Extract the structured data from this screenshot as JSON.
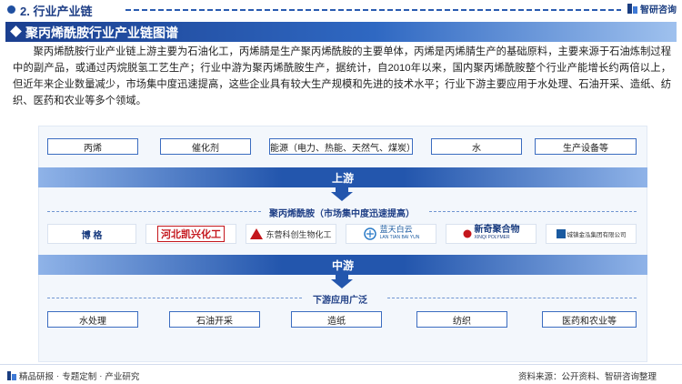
{
  "section_title": "2. 行业产业链",
  "brand": "智研咨询",
  "diagram_title": "聚丙烯酰胺行业产业链图谱",
  "intro": "聚丙烯酰胺行业产业链上游主要为石油化工，丙烯腈是生产聚丙烯酰胺的主要单体，丙烯是丙烯腈生产的基础原料，主要来源于石油炼制过程中的副产品，或通过丙烷脱氢工艺生产；行业中游为聚丙烯酰胺生产，据统计，自2010年以来，国内聚丙烯酰胺整个行业产能增长约两倍以上，但近年来企业数量减少，市场集中度迅速提高，这些企业具有较大生产规模和先进的技术水平；行业下游主要应用于水处理、石油开采、造纸、纺织、医药和农业等多个领域。",
  "upstream": {
    "items": [
      "丙烯",
      "催化剂",
      "能源（电力、热能、天然气、煤炭）",
      "水",
      "生产设备等"
    ],
    "bar_label": "上游"
  },
  "midstream": {
    "label": "聚丙烯酰胺（市场集中度迅速提高）",
    "companies": [
      "博 格",
      "河北凯兴化工",
      "东营科创生物化工",
      "蓝天白云",
      "新奇聚合物",
      "城镇金泓集团有限公司"
    ],
    "xinqi_sub": "XINQI POLYMER",
    "lantian_sub": "LAN TIAN BAI YUN",
    "bar_label": "中游"
  },
  "downstream": {
    "label": "下游应用广泛",
    "items": [
      "水处理",
      "石油开采",
      "造纸",
      "纺织",
      "医药和农业等"
    ]
  },
  "footer": {
    "left": [
      "精品研报",
      "·",
      "专题定制",
      "·",
      "产业研究"
    ],
    "source": "资料来源：公开资料、智研咨询整理"
  },
  "colors": {
    "primary": "#2356ad",
    "dark": "#1f3f86",
    "panel": "#f3f7fc"
  }
}
